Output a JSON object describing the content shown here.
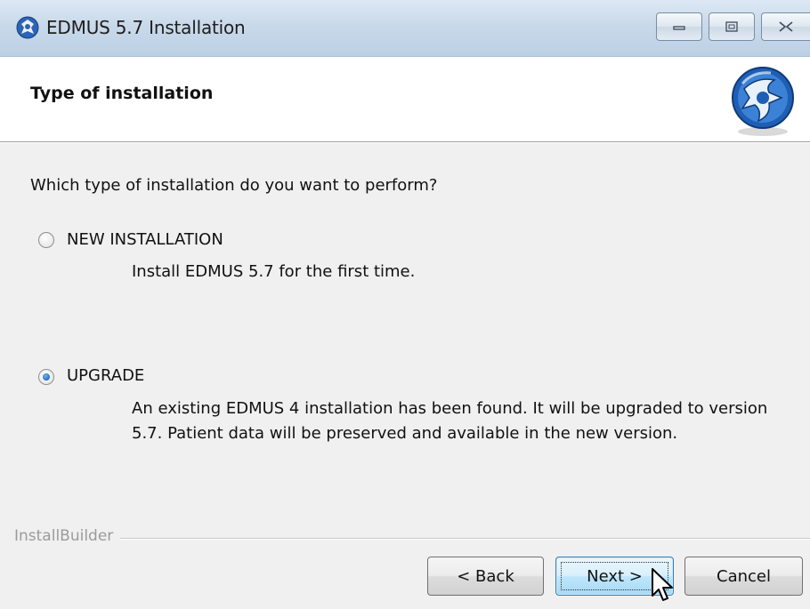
{
  "window": {
    "title": "EDMUS 5.7 Installation",
    "icons": [
      "app-icon",
      "minimize-icon",
      "maximize-icon",
      "close-icon"
    ]
  },
  "header": {
    "title": "Type of installation",
    "logo": "edmus-logo"
  },
  "body": {
    "question": "Which type of installation do you want to perform?",
    "options": [
      {
        "label": "NEW INSTALLATION",
        "description": [
          "Install EDMUS 5.7 for the first time."
        ],
        "selected": false
      },
      {
        "label": "UPGRADE",
        "description": [
          "An existing EDMUS 4 installation has been found. It will be upgraded to version",
          "5.7. Patient data will be preserved and available in the new version."
        ],
        "selected": true
      }
    ]
  },
  "footer": {
    "brand": "InstallBuilder",
    "buttons": {
      "back": "< Back",
      "next": "Next >",
      "cancel": "Cancel"
    }
  },
  "colors": {
    "titlebar": "#c9d9ea",
    "accent": "#1f6fc1",
    "next_button": "#bee6fd"
  }
}
